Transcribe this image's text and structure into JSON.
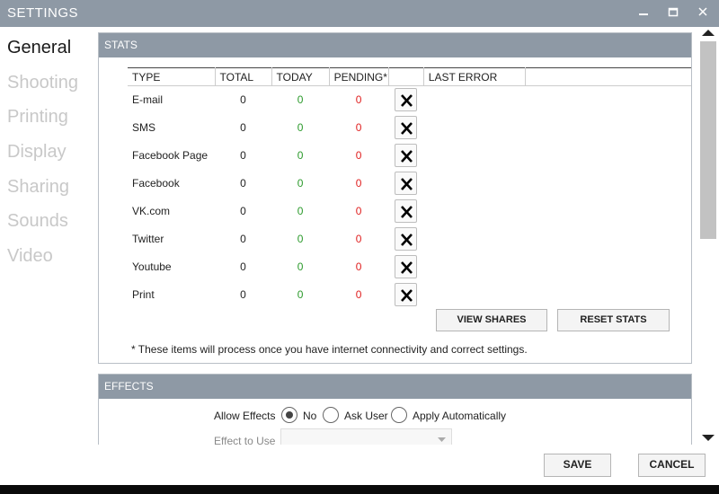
{
  "window": {
    "title": "SETTINGS"
  },
  "sidebar": {
    "items": [
      {
        "label": "General",
        "active": true
      },
      {
        "label": "Shooting",
        "active": false
      },
      {
        "label": "Printing",
        "active": false
      },
      {
        "label": "Display",
        "active": false
      },
      {
        "label": "Sharing",
        "active": false
      },
      {
        "label": "Sounds",
        "active": false
      },
      {
        "label": "Video",
        "active": false
      }
    ]
  },
  "stats": {
    "header": "STATS",
    "columns": [
      "TYPE",
      "TOTAL",
      "TODAY",
      "PENDING*",
      "",
      "LAST ERROR"
    ],
    "rows": [
      {
        "type": "E-mail",
        "total": "0",
        "today": "0",
        "pending": "0"
      },
      {
        "type": "SMS",
        "total": "0",
        "today": "0",
        "pending": "0"
      },
      {
        "type": "Facebook Page",
        "total": "0",
        "today": "0",
        "pending": "0"
      },
      {
        "type": "Facebook",
        "total": "0",
        "today": "0",
        "pending": "0"
      },
      {
        "type": "VK.com",
        "total": "0",
        "today": "0",
        "pending": "0"
      },
      {
        "type": "Twitter",
        "total": "0",
        "today": "0",
        "pending": "0"
      },
      {
        "type": "Youtube",
        "total": "0",
        "today": "0",
        "pending": "0"
      },
      {
        "type": "Print",
        "total": "0",
        "today": "0",
        "pending": "0"
      }
    ],
    "view_shares_label": "VIEW SHARES",
    "reset_stats_label": "RESET STATS",
    "note": "* These items will process once you have internet connectivity and correct settings."
  },
  "effects": {
    "header": "EFFECTS",
    "allow_label": "Allow Effects",
    "options": [
      {
        "label": "No",
        "checked": true
      },
      {
        "label": "Ask User",
        "checked": false
      },
      {
        "label": "Apply Automatically",
        "checked": false
      }
    ],
    "effect_to_use_label": "Effect to Use",
    "effect_to_use_value": ""
  },
  "footer": {
    "save_label": "SAVE",
    "cancel_label": "CANCEL"
  },
  "colors": {
    "header_bg": "#8e99a5",
    "today": "#2c9a2c",
    "pending": "#e02020"
  },
  "icons": [
    "minimize-icon",
    "maximize-icon",
    "close-icon",
    "x-icon",
    "radio-icon",
    "chevron-down-icon",
    "scroll-up-icon",
    "scroll-down-icon"
  ]
}
